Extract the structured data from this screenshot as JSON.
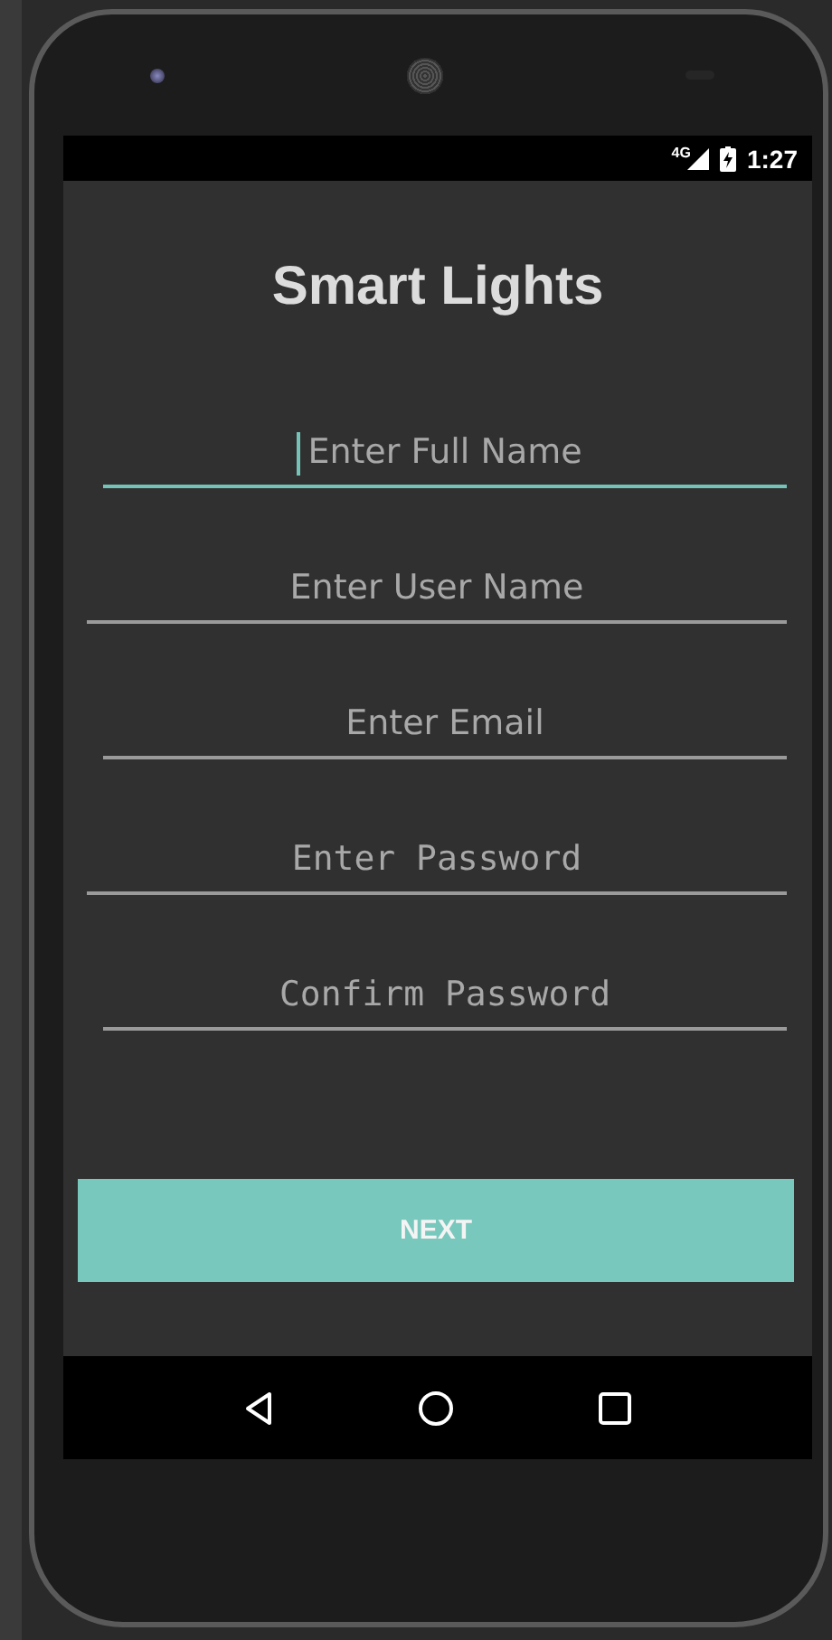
{
  "status_bar": {
    "network": "4G",
    "time": "1:27"
  },
  "title": "Smart Lights",
  "fields": [
    {
      "placeholder": "Enter Full Name",
      "kind": "text",
      "focused": true
    },
    {
      "placeholder": "Enter User Name",
      "kind": "text",
      "focused": false
    },
    {
      "placeholder": "Enter Email",
      "kind": "text",
      "focused": false
    },
    {
      "placeholder": "Enter Password",
      "kind": "password",
      "focused": false
    },
    {
      "placeholder": "Confirm Password",
      "kind": "password",
      "focused": false
    }
  ],
  "button": "NEXT"
}
